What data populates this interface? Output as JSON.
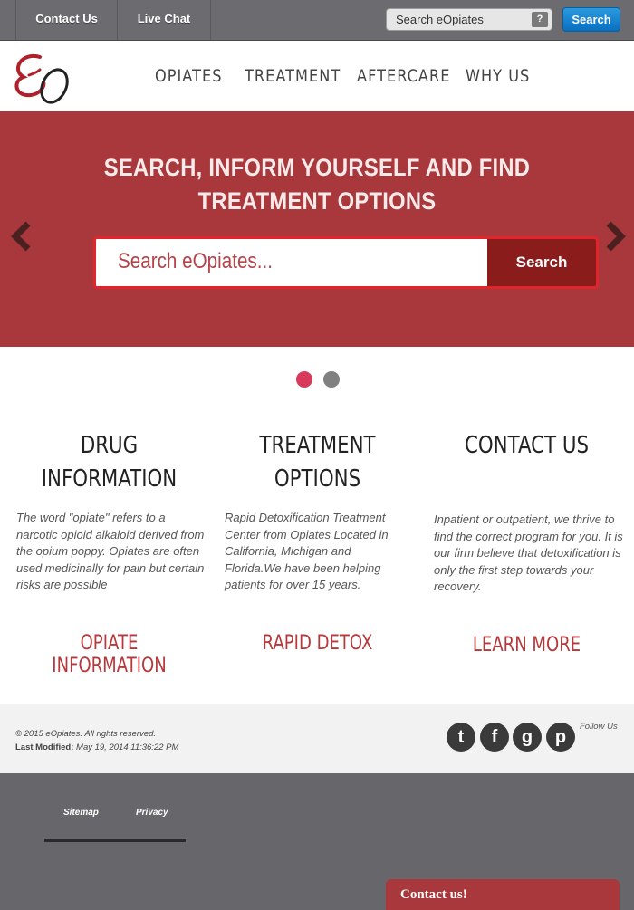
{
  "topbar": {
    "contact_label": "Contact Us",
    "chat_label": "Live Chat",
    "search_placeholder": "Search eOpiates",
    "help_label": "?",
    "search_button": "Search"
  },
  "nav": {
    "items": [
      "OPIATES",
      "TREATMENT",
      "AFTERCARE",
      "WHY US"
    ]
  },
  "hero": {
    "title_line1": "SEARCH, INFORM YOURSELF AND FIND",
    "title_line2": "TREATMENT OPTIONS",
    "search_placeholder": "Search eOpiates...",
    "search_button": "Search"
  },
  "columns": [
    {
      "title_line1": "DRUG",
      "title_line2": "INFORMATION",
      "text": "The word \"opiate\" refers to a narcotic opioid alkaloid derived from the opium poppy. Opiates are often used medicinally for pain but certain risks are possible",
      "cta": "OPIATE INFORMATION"
    },
    {
      "title_line1": "TREATMENT",
      "title_line2": "OPTIONS",
      "text": "Rapid Detoxification Treatment Center from Opiates Located in California, Michigan and Florida.We have been helping patients for over 15 years.",
      "cta": "RAPID DETOX"
    },
    {
      "title_line1": "CONTACT US",
      "title_line2": "",
      "text": "Inpatient or outpatient, we thrive to find the correct program for you. It is our firm believe that detoxification is only the first step towards your recovery.",
      "cta": "LEARN MORE"
    }
  ],
  "footer": {
    "copyright": "© 2015 eOpiates. All rights reserved.",
    "modified_label": "Last Modified:",
    "modified_value": "May 19, 2014 11:36:22 PM",
    "follow_label": "Follow Us",
    "social": [
      {
        "icon": "tumblr-icon",
        "glyph": "t"
      },
      {
        "icon": "facebook-icon",
        "glyph": "f"
      },
      {
        "icon": "google-plus-icon",
        "glyph": "g"
      },
      {
        "icon": "pinterest-icon",
        "glyph": "p"
      }
    ]
  },
  "bottom": {
    "sitemap_label": "Sitemap",
    "privacy_label": "Privacy",
    "chat_tab": "Contact us!"
  },
  "colors": {
    "hero_red": "#a8383b",
    "accent_red": "#b8373a",
    "dot_active": "#d83a5c",
    "dot_inactive": "#808080",
    "topbar_gray": "#6b6b70"
  }
}
